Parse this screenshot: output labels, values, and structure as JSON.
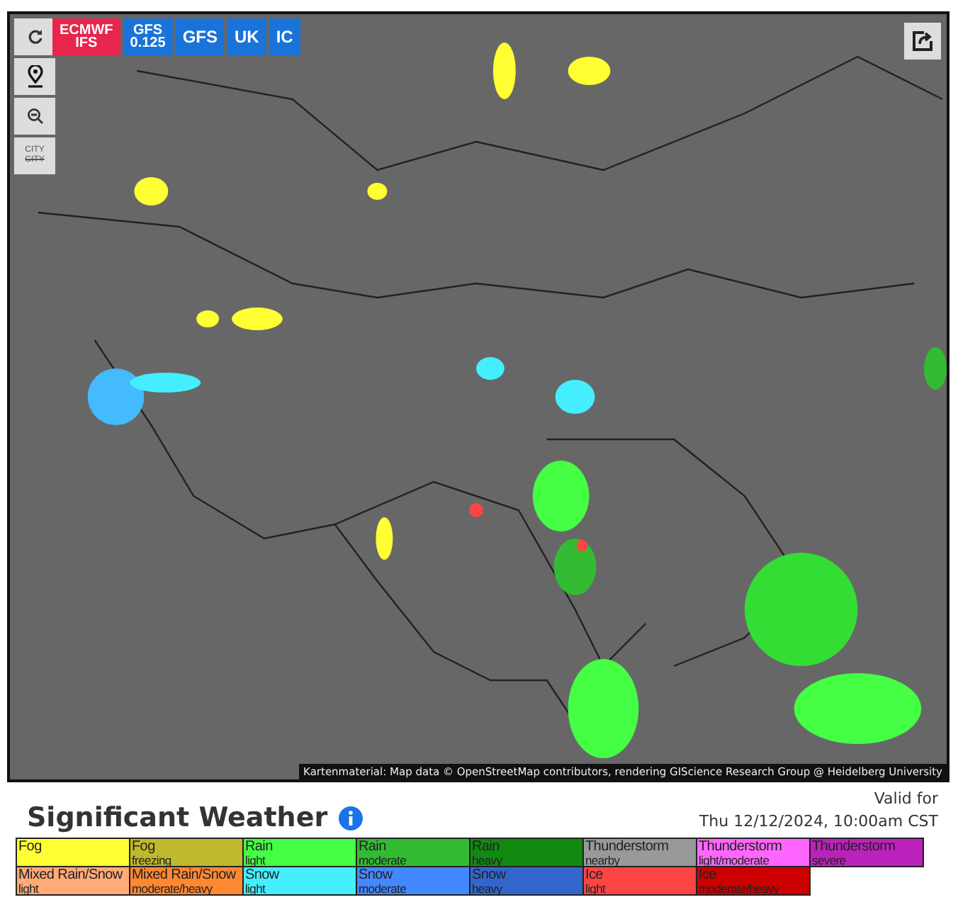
{
  "map": {
    "models": [
      {
        "label": "ECMWF IFS",
        "selected": true
      },
      {
        "label": "GFS 0.125",
        "selected": false
      },
      {
        "label": "GFS",
        "selected": false
      },
      {
        "label": "UK",
        "selected": false
      },
      {
        "label": "IC",
        "selected": false
      }
    ],
    "city_toggle": {
      "label": "CITY",
      "struck_label": "CITY"
    },
    "attribution": "Kartenmaterial: Map data © OpenStreetMap contributors, rendering GIScience Research Group @ Heidelberg University"
  },
  "legend": {
    "title": "Significant Weather",
    "valid_label": "Valid for",
    "valid_time": "Thu 12/12/2024, 10:00am CST",
    "rows": [
      [
        {
          "name": "Fog",
          "color": "#ffff33"
        },
        {
          "name": "Fog",
          "sub": "freezing",
          "color": "#c0b82e"
        },
        {
          "name": "Rain",
          "sub": "light",
          "color": "#44ff44"
        },
        {
          "name": "Rain",
          "sub": "moderate",
          "color": "#33bb33"
        },
        {
          "name": "Rain",
          "sub": "heavy",
          "color": "#128a12"
        },
        {
          "name": "Thunderstorm",
          "sub": "nearby",
          "color": "#999999"
        },
        {
          "name": "Thunderstorm",
          "sub": "light/moderate",
          "color": "#ff66ff"
        },
        {
          "name": "Thunderstorm",
          "sub": "severe",
          "color": "#bb22bb"
        }
      ],
      [
        {
          "name": "Mixed Rain/Snow",
          "sub": "light",
          "color": "#ffaa77"
        },
        {
          "name": "Mixed Rain/Snow",
          "sub": "moderate/heavy",
          "color": "#ff8833"
        },
        {
          "name": "Snow",
          "sub": "light",
          "color": "#44eeff"
        },
        {
          "name": "Snow",
          "sub": "moderate",
          "color": "#4488ff"
        },
        {
          "name": "Snow",
          "sub": "heavy",
          "color": "#3366cc"
        },
        {
          "name": "Ice",
          "sub": "light",
          "color": "#ff4444"
        },
        {
          "name": "Ice",
          "sub": "moderate/heavy",
          "color": "#cc0000"
        }
      ]
    ]
  }
}
